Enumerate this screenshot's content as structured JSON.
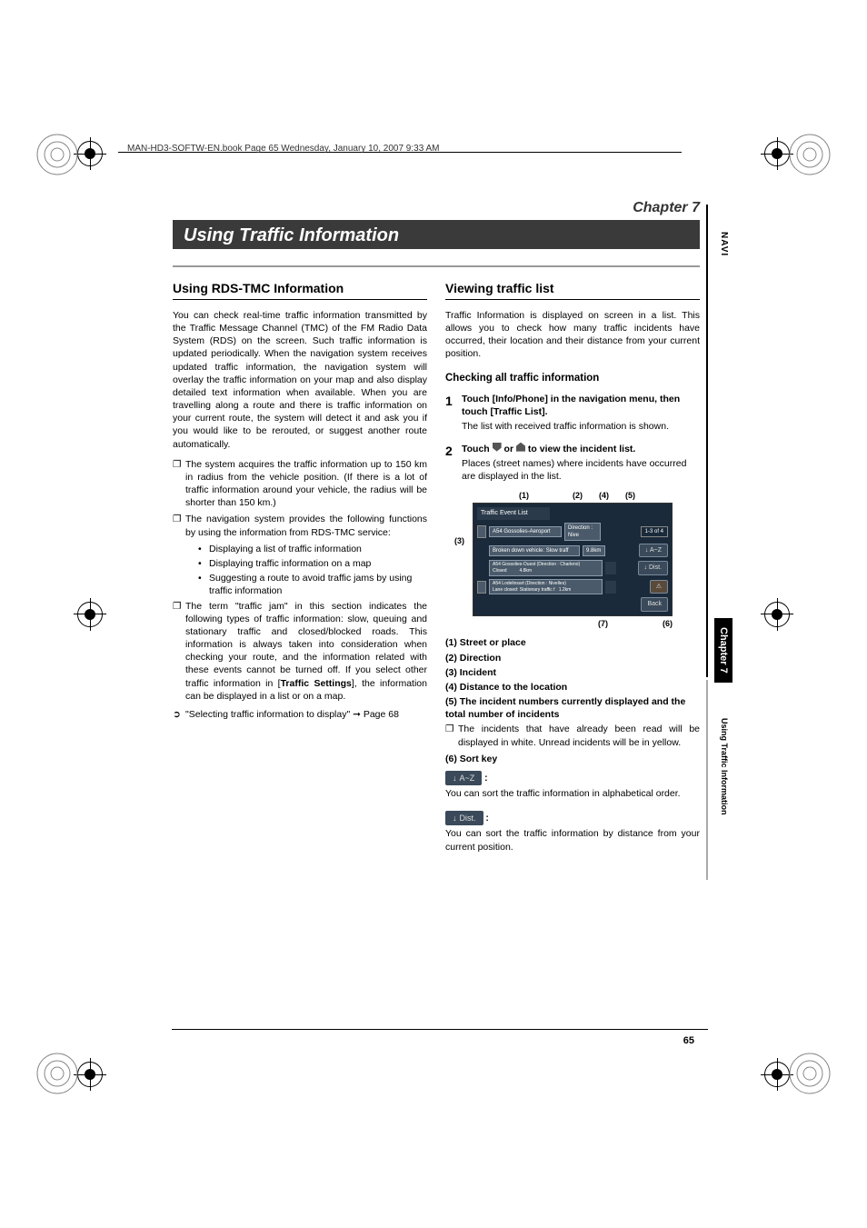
{
  "header": {
    "running": "MAN-HD3-SOFTW-EN.book  Page 65  Wednesday, January 10, 2007  9:33 AM"
  },
  "chapter_label": "Chapter 7",
  "title": "Using Traffic Information",
  "side": {
    "navi": "NAVI",
    "chapter": "Chapter 7",
    "section": "Using Traffic Information"
  },
  "left": {
    "h2": "Using RDS-TMC Information",
    "intro": "You can check real-time traffic information trans­mitted by the Traffic Message Channel (TMC) of the FM Radio Data System (RDS) on the screen. Such traffic information is updated periodically. When the navigation system receives updated traffic information, the navigation system will overlay the traffic information on your map and also display detailed text information when availa­ble. When you are travelling along a route and there is traffic information on your current route, the system will detect it and ask you if you would like to be rerouted, or suggest another route auto­matically.",
    "b1": "The system acquires the traffic information up to 150 km in radius from the vehicle position. (If there is a lot of traffic information around your vehicle, the radius will be shorter than 150 km.)",
    "b2": "The navigation system provides the following functions by using the information from RDS-TMC service:",
    "sb1": "Displaying a list of traffic information",
    "sb2": "Displaying traffic information on a map",
    "sb3": "Suggesting a route to avoid traffic jams by using traffic information",
    "b3a": "The term \"traffic jam\" in this section indicates the following types of traffic information: slow, queuing and stationary traffic and closed/blocked roads. This information is always taken into consideration when checking your route, and the information related with these events cannot be turned off. If you select other traffic information in [",
    "b3b": "Traffic Settings",
    "b3c": "], the information can be displayed in a list or on a map.",
    "xref": "\"Selecting traffic information to display\" ➞ Page 68"
  },
  "right": {
    "h2": "Viewing traffic list",
    "intro": "Traffic Information is displayed on screen in a list. This allows you to check how many traffic inci­dents have occurred, their location and their dis­tance from your current position.",
    "h3": "Checking all traffic information",
    "step1_title": "Touch [Info/Phone] in the navigation menu, then touch [Traffic List].",
    "step1_desc": "The list with received traffic information is shown.",
    "step2_title_a": "Touch ",
    "step2_title_b": " or ",
    "step2_title_c": " to view the incident list.",
    "step2_desc": "Places (street names) where incidents have occurred are displayed in the list.",
    "callouts": {
      "c1": "(1)",
      "c2": "(2)",
      "c3": "(3)",
      "c4": "(4)",
      "c5": "(5)",
      "c6": "(6)",
      "c7": "(7)"
    },
    "screen": {
      "title": "Traffic Event List",
      "row1a": "A54 Gossolies-Aeroport",
      "row1b": "Direction : Nive",
      "row2": "Broken down vehicle: Slow traff",
      "row2d": "9.8km",
      "count": "1-3 of 4",
      "btn_az": "A~Z",
      "row3a": "A54 Gossolies-Ouest (Direction : Charleroi)",
      "row3b": "Closed",
      "row3d": "4.8km",
      "btn_dist": "Dist.",
      "row4a": "A54 Lodelinsart (Direction : Nivelles)",
      "row4b": "Lane closed: Stationary traffic f",
      "row4d": "1.2km",
      "btn_back": "Back"
    },
    "legend": {
      "l1": "(1) Street or place",
      "l2": "(2) Direction",
      "l3": "(3) Incident",
      "l4": "(4) Distance to the location",
      "l5": "(5) The incident numbers currently dis­played and the total number of incidents",
      "l5_note": "The incidents that have already been read will be displayed in white. Unread inci­dents will be in yellow.",
      "l6": "(6) Sort key",
      "sort_az": "A~Z",
      "sort_az_desc": "You can sort the traffic information in alpha­betical order.",
      "sort_dist": "Dist.",
      "sort_dist_desc": "You can sort the traffic information by dis­tance from your current position."
    }
  },
  "page_num": "65"
}
